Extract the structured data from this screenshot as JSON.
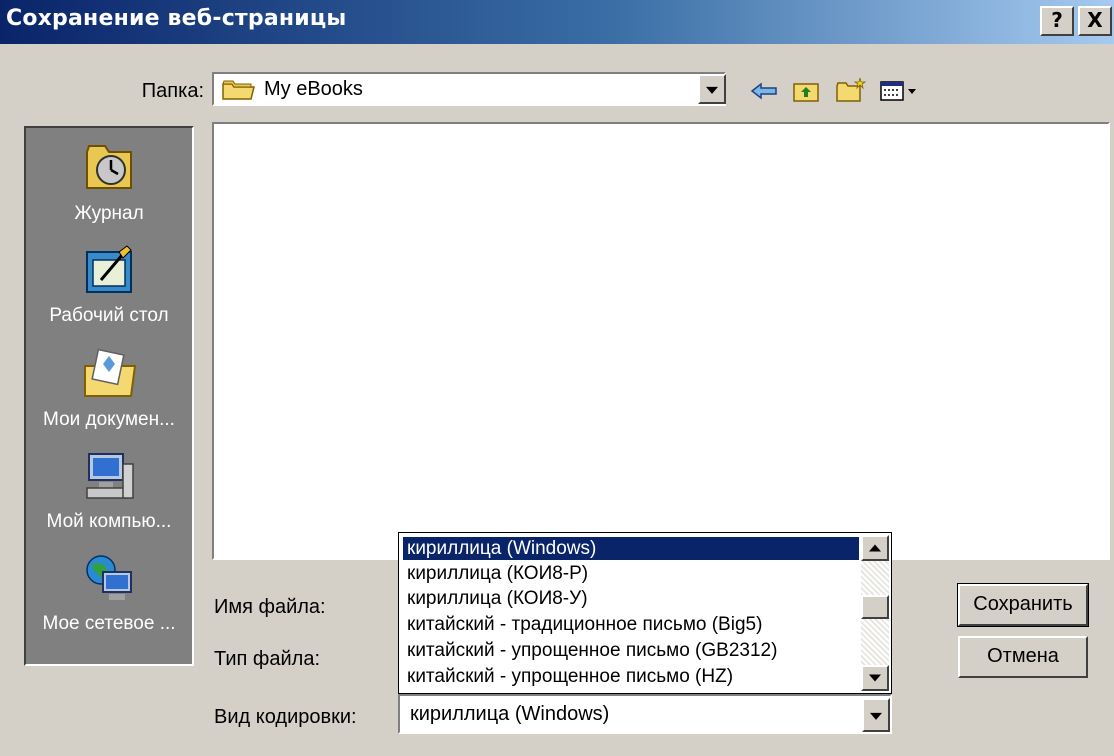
{
  "window": {
    "title": "Сохранение веб-страницы",
    "help_label": "?",
    "close_label": "X"
  },
  "folder": {
    "label": "Папка:",
    "value": "My eBooks"
  },
  "toolbar": {
    "icons": [
      "back-icon",
      "up-folder-icon",
      "new-folder-icon",
      "view-menu-icon"
    ]
  },
  "places": [
    {
      "label": "Журнал",
      "icon": "history-icon"
    },
    {
      "label": "Рабочий стол",
      "icon": "desktop-icon"
    },
    {
      "label": "Мои докумен...",
      "icon": "my-documents-icon"
    },
    {
      "label": "Мой компью...",
      "icon": "my-computer-icon"
    },
    {
      "label": "Мое сетевое ...",
      "icon": "network-icon"
    }
  ],
  "fields": {
    "filename_label": "Имя файла:",
    "filetype_label": "Тип файла:",
    "encoding_label": "Вид кодировки:"
  },
  "encoding": {
    "value": "кириллица (Windows)",
    "options": [
      "кириллица (Windows)",
      "кириллица (КОИ8-Р)",
      "кириллица (КОИ8-У)",
      "китайский - традиционное письмо (Big5)",
      "китайский - упрощенное письмо (GB2312)",
      "китайский - упрощенное письмо (HZ)"
    ],
    "selected_index": 0
  },
  "buttons": {
    "save": "Сохранить",
    "cancel": "Отмена"
  },
  "colors": {
    "title_bar_start": "#0a246a",
    "title_bar_end": "#a6caf0",
    "selection": "#0a246a",
    "face": "#d4d0c8"
  }
}
